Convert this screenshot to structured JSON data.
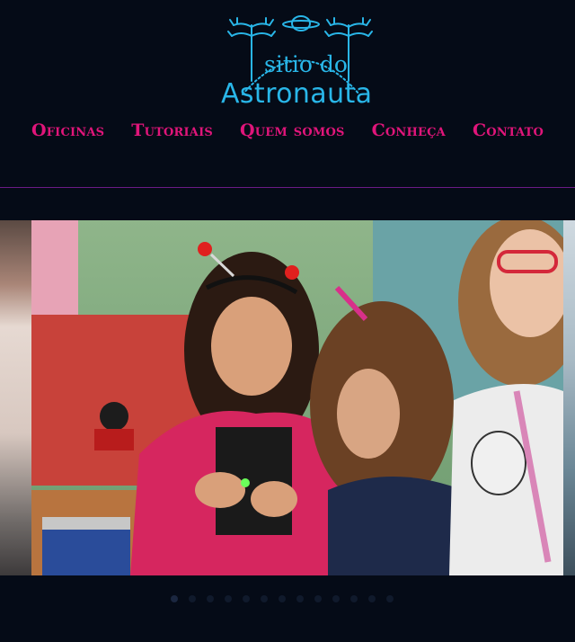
{
  "site": {
    "logo_line1": "sitio do",
    "logo_line2": "Astronauta",
    "logo_color": "#29b6e8"
  },
  "nav": {
    "items": [
      {
        "label": "Oficinas"
      },
      {
        "label": "Tutoriais"
      },
      {
        "label": "Quem somos"
      },
      {
        "label": "Conheça"
      },
      {
        "label": "Contato"
      }
    ],
    "color": "#e0157a"
  },
  "slider": {
    "image_alt": "Crianças montando circuito com LED",
    "total_slides": 13,
    "active_index": 0
  },
  "colors": {
    "background": "#050b17",
    "divider": "#6b1a86"
  }
}
